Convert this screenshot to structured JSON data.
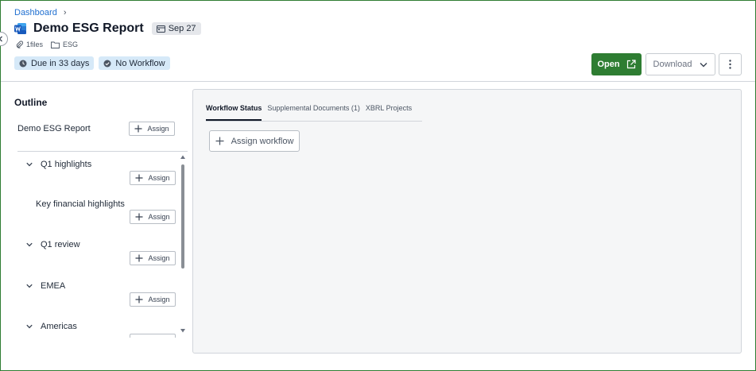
{
  "breadcrumb": {
    "root": "Dashboard"
  },
  "document": {
    "title": "Demo ESG Report",
    "date": "Sep 27",
    "files": "1files",
    "folder": "ESG"
  },
  "status": {
    "due": "Due in 33 days",
    "workflow": "No Workflow"
  },
  "actions": {
    "open": "Open",
    "download": "Download"
  },
  "outline": {
    "heading": "Outline",
    "root": "Demo ESG Report",
    "assign_label": "Assign",
    "items": [
      {
        "label": "Q1 highlights"
      },
      {
        "label": "Key financial highlights"
      },
      {
        "label": "Q1 review"
      },
      {
        "label": "EMEA"
      },
      {
        "label": "Americas"
      }
    ]
  },
  "panel": {
    "tabs": [
      {
        "label": "Workflow Status"
      },
      {
        "label": "Supplemental Documents (1)"
      },
      {
        "label": "XBRL Projects"
      }
    ],
    "assign_workflow": "Assign workflow"
  },
  "colors": {
    "accent_green": "#2e7d32",
    "link_blue": "#1f6fd0",
    "pill_blue": "#d6e9f8"
  }
}
